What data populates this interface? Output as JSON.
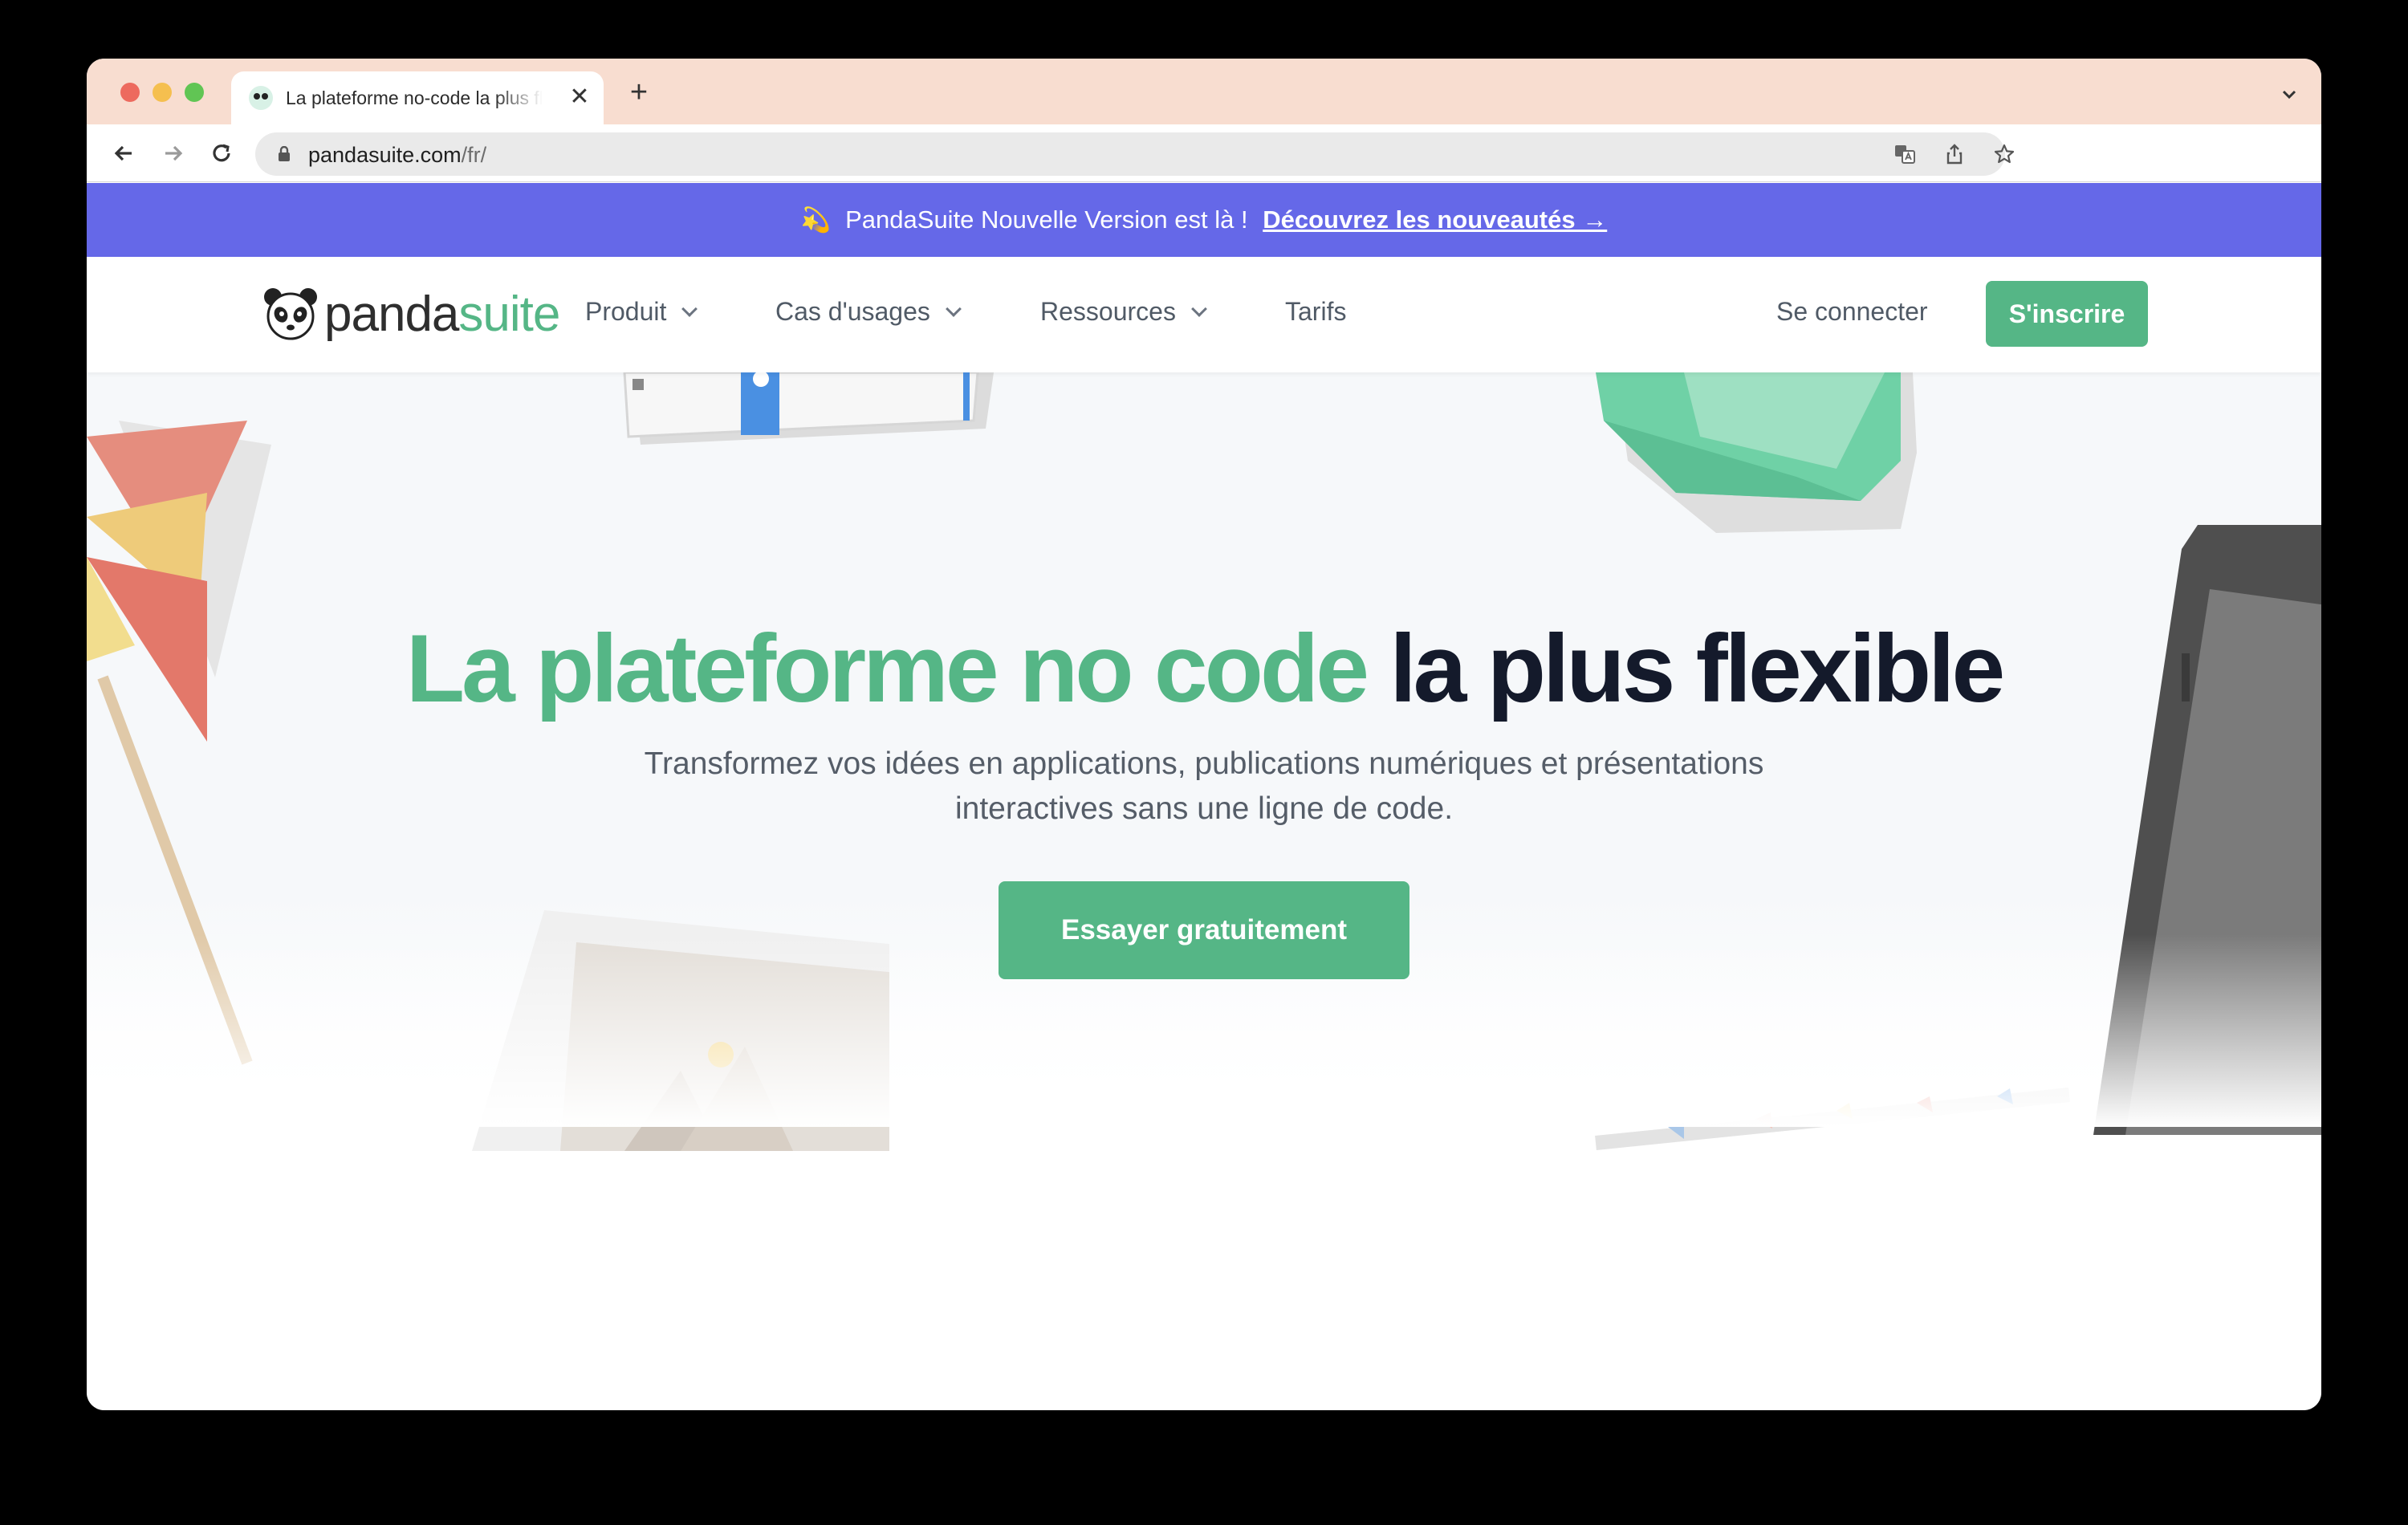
{
  "browser": {
    "tab_title": "La plateforme no-code la plus flexible",
    "tab_close": "✕",
    "new_tab": "+",
    "url_host": "pandasuite.com",
    "url_path": "/fr/"
  },
  "announcement": {
    "emoji": "💫",
    "text": "PandaSuite Nouvelle Version est là !",
    "link": "Découvrez les nouveautés →",
    "background": "#6568e8"
  },
  "nav": {
    "logo_panda": "panda",
    "logo_suite": "suite",
    "items": [
      {
        "label": "Produit"
      },
      {
        "label": "Cas d'usages"
      },
      {
        "label": "Ressources"
      },
      {
        "label": "Tarifs"
      }
    ],
    "login": "Se connecter",
    "signup": "S'inscrire"
  },
  "hero": {
    "headline_green": "La plateforme no code",
    "headline_dark": "la plus flexible",
    "subtitle": "Transformez vos idées en applications, publications numériques et présentations interactives sans une ligne de code.",
    "cta": "Essayer gratuitement"
  },
  "colors": {
    "brand_green": "#55b686",
    "headline_dark": "#141a2b"
  }
}
